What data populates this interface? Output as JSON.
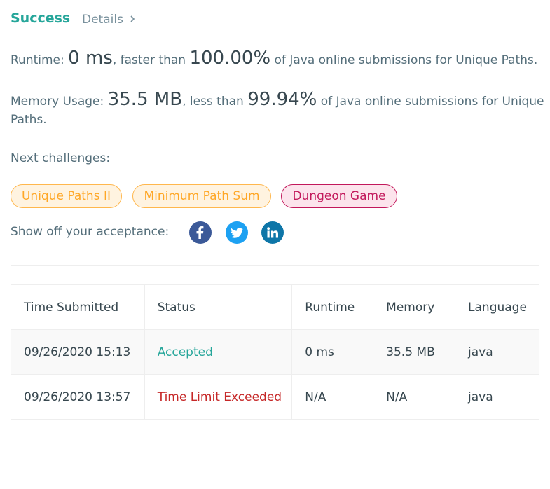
{
  "header": {
    "status": "Success",
    "details_label": "Details"
  },
  "stats": {
    "runtime_label": "Runtime: ",
    "runtime_value": "0 ms",
    "runtime_mid": ", faster than ",
    "runtime_percent": "100.00%",
    "runtime_suffix": " of Java online submissions for Unique Paths.",
    "memory_label": "Memory Usage: ",
    "memory_value": "35.5 MB",
    "memory_mid": ", less than ",
    "memory_percent": "99.94%",
    "memory_suffix_line1": " of Java online submissions for Unique",
    "memory_suffix_line2": "Paths."
  },
  "next_challenges": {
    "label": "Next challenges:",
    "items": [
      {
        "label": "Unique Paths II",
        "difficulty": "medium"
      },
      {
        "label": "Minimum Path Sum",
        "difficulty": "medium"
      },
      {
        "label": "Dungeon Game",
        "difficulty": "hard"
      }
    ]
  },
  "share": {
    "label": "Show off your acceptance:",
    "icons": [
      "facebook-icon",
      "twitter-icon",
      "linkedin-icon"
    ]
  },
  "table": {
    "headers": [
      "Time Submitted",
      "Status",
      "Runtime",
      "Memory",
      "Language"
    ],
    "rows": [
      {
        "time": "09/26/2020 15:13",
        "status": "Accepted",
        "runtime": "0 ms",
        "memory": "35.5 MB",
        "language": "java"
      },
      {
        "time": "09/26/2020 13:57",
        "status": "Time Limit Exceeded",
        "runtime": "N/A",
        "memory": "N/A",
        "language": "java"
      }
    ]
  },
  "colors": {
    "success": "#26a69a",
    "error": "#c62828",
    "medium_tag": "#ffa726",
    "hard_tag": "#c2185b",
    "facebook": "#3b5998",
    "twitter": "#1da1f2",
    "linkedin": "#0e76a8"
  }
}
